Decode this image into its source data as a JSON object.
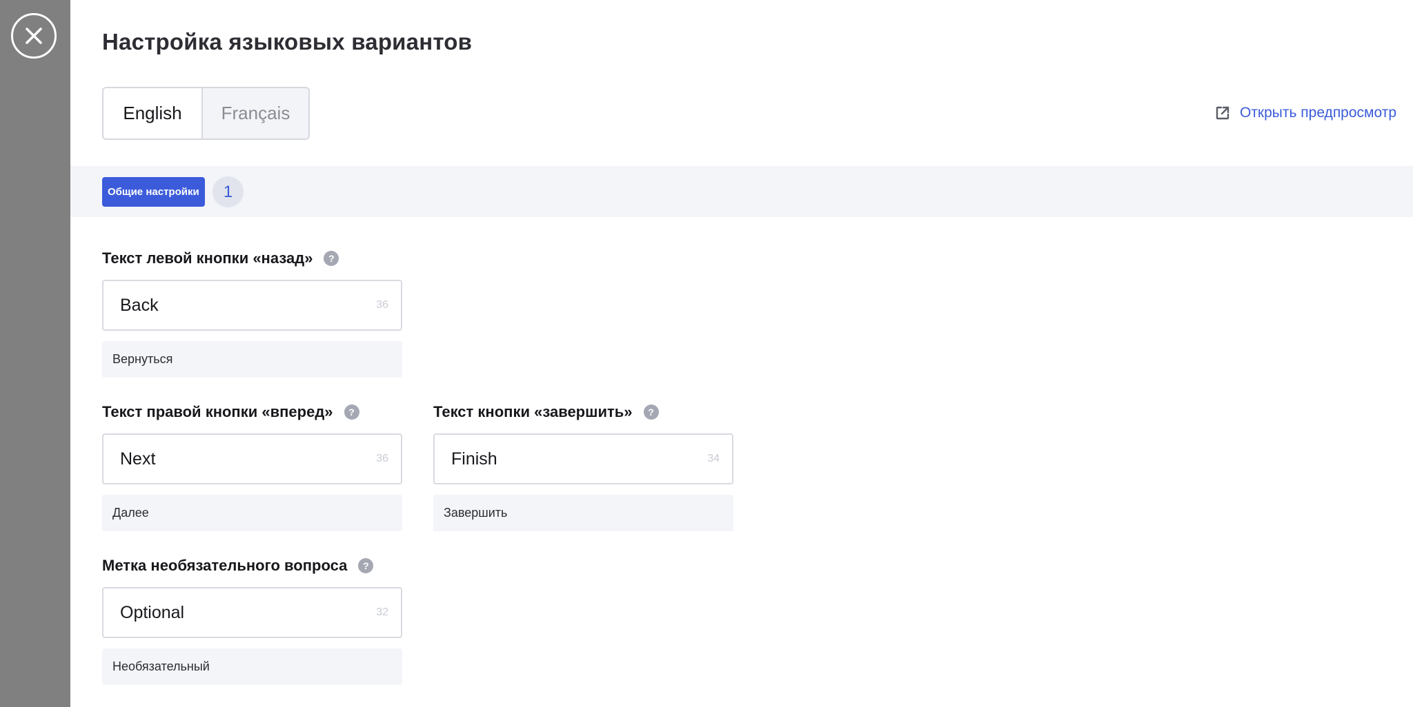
{
  "page": {
    "title": "Настройка языковых вариантов",
    "preview_link": "Открыть предпросмотр"
  },
  "icons": {
    "close": "close-icon",
    "external": "external-link-icon",
    "help": "help-icon"
  },
  "colors": {
    "accent": "#3b5bdb",
    "rail": "#808080",
    "section_bg": "#f4f5f9"
  },
  "languages": [
    {
      "label": "English",
      "active": true
    },
    {
      "label": "Français",
      "active": false
    }
  ],
  "section": {
    "tab_label": "Общие настройки",
    "badge_count": "1"
  },
  "fields": {
    "back": {
      "label": "Текст левой кнопки «назад»",
      "help": "?",
      "value": "Back",
      "remaining": "36",
      "translation": "Вернуться"
    },
    "next": {
      "label": "Текст правой кнопки «вперед»",
      "help": "?",
      "value": "Next",
      "remaining": "36",
      "translation": "Далее"
    },
    "finish": {
      "label": "Текст кнопки «завершить»",
      "help": "?",
      "value": "Finish",
      "remaining": "34",
      "translation": "Завершить"
    },
    "optional": {
      "label": "Метка необязательного вопроса",
      "help": "?",
      "value": "Optional",
      "remaining": "32",
      "translation": "Необязательный"
    }
  }
}
